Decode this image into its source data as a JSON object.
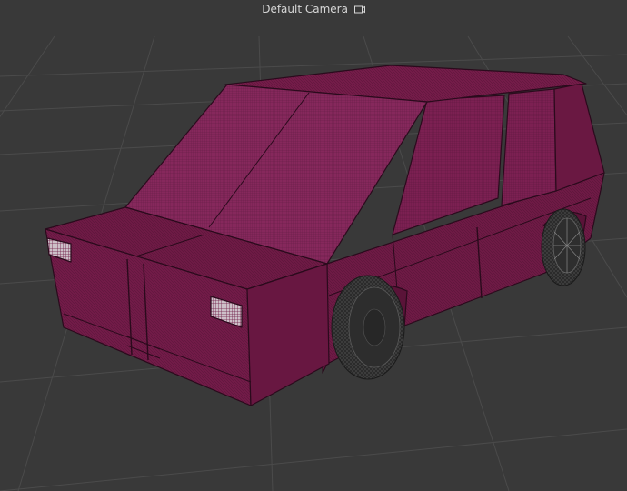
{
  "viewport": {
    "camera_label": "Default Camera",
    "camera_icon": "camera-icon",
    "background_color": "#393939",
    "grid_color": "#4a4a4a",
    "car_body_color": "#6e1a45",
    "car_window_color": "#86285c",
    "wire_color": "#2a0a1c",
    "tire_color": "#2b2b2b"
  }
}
